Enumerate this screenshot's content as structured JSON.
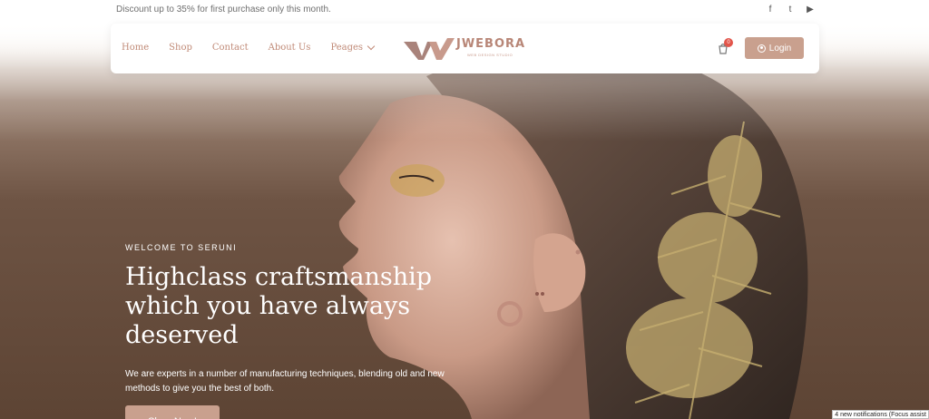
{
  "topbar": {
    "promo": "Discount up to 35% for first purchase only this month.",
    "socials": [
      {
        "icon": "facebook-icon",
        "glyph": "f"
      },
      {
        "icon": "twitter-icon",
        "glyph": "t"
      },
      {
        "icon": "youtube-icon",
        "glyph": "▶"
      }
    ]
  },
  "nav": {
    "links": [
      "Home",
      "Shop",
      "Contact",
      "About Us"
    ],
    "dropdown_label": "Peages",
    "logo_word": "JWEBORA",
    "logo_sub": "WEB DESIGN STUDIO",
    "cart_count": "0",
    "login_label": "Login"
  },
  "hero": {
    "eyebrow": "WELCOME TO SERUNI",
    "headline": "Highclass craftsmanship which you have always deserved",
    "description": "We are experts in a number of manufacturing techniques, blending old and new methods to give you the best of both.",
    "cta": "Shop Now!"
  },
  "system": {
    "notification": "4 new notifications (Focus assist"
  },
  "colors": {
    "accent": "#c9a08e",
    "nav_text": "#c08a77",
    "badge": "#e2554a"
  }
}
